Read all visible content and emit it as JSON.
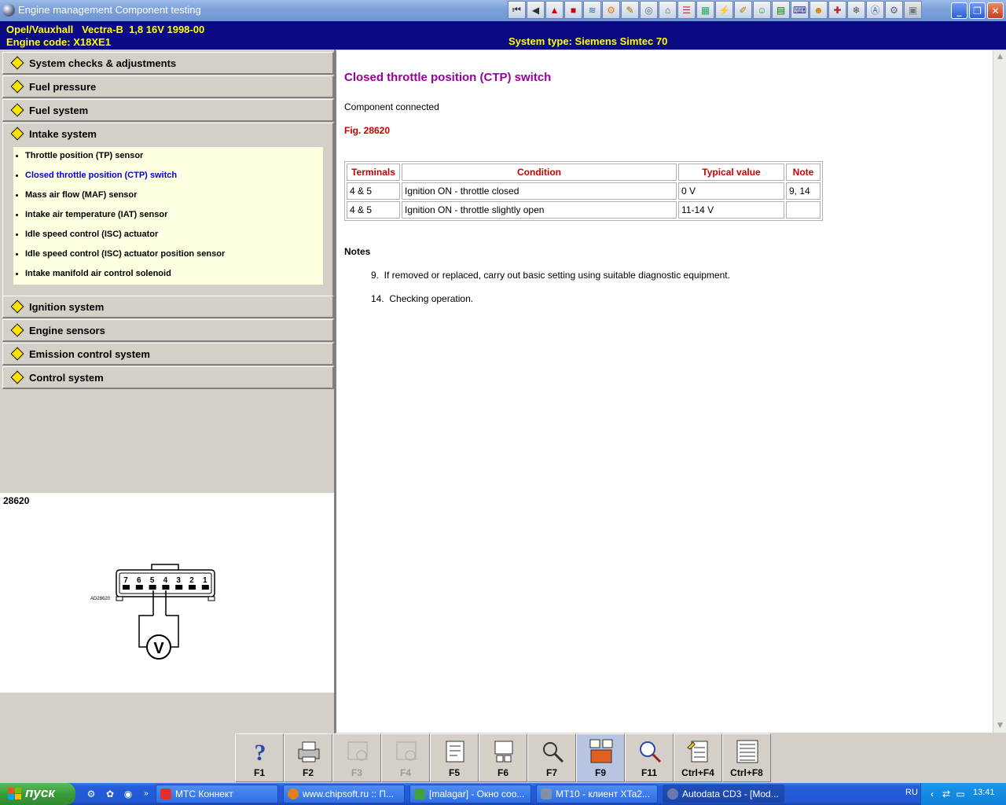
{
  "window": {
    "title": "Engine management Component testing"
  },
  "header": {
    "vehicle": "Opel/Vauxhall   Vectra-B  1,8 16V 1998-00",
    "engine_code": "Engine code: X18XE1",
    "system_type": "System type: Siemens Simtec 70"
  },
  "sections": [
    {
      "label": "System checks & adjustments"
    },
    {
      "label": "Fuel pressure"
    },
    {
      "label": "Fuel system"
    },
    {
      "label": "Intake system"
    },
    {
      "label": "Ignition system"
    },
    {
      "label": "Engine sensors"
    },
    {
      "label": "Emission control system"
    },
    {
      "label": "Control system"
    }
  ],
  "intake_items": [
    {
      "label": "Throttle position (TP) sensor"
    },
    {
      "label": "Closed throttle position (CTP) switch"
    },
    {
      "label": "Mass air flow (MAF) sensor"
    },
    {
      "label": "Intake air temperature (IAT) sensor"
    },
    {
      "label": "Idle speed control (ISC) actuator"
    },
    {
      "label": "Idle speed control (ISC) actuator position sensor"
    },
    {
      "label": "Intake manifold air control solenoid"
    }
  ],
  "figure": {
    "number": "28620",
    "code": "AD28620",
    "pins": [
      "7",
      "6",
      "5",
      "4",
      "3",
      "2",
      "1"
    ],
    "meter": "V"
  },
  "content": {
    "title": "Closed throttle position (CTP) switch",
    "connection": "Component connected",
    "fig_ref": "Fig. 28620",
    "table": {
      "headers": [
        "Terminals",
        "Condition",
        "Typical value",
        "Note"
      ],
      "rows": [
        [
          "4 & 5",
          "Ignition ON - throttle closed",
          "0 V",
          "9, 14"
        ],
        [
          "4 & 5",
          "Ignition ON - throttle slightly open",
          "11-14 V",
          ""
        ]
      ]
    },
    "notes_heading": "Notes",
    "notes": [
      "9.  If removed or replaced, carry out basic setting using suitable diagnostic equipment.",
      "14.  Checking operation."
    ]
  },
  "fkeys": [
    {
      "label": "F1",
      "icon": "help-icon"
    },
    {
      "label": "F2",
      "icon": "printer-icon"
    },
    {
      "label": "F3",
      "icon": "component-location-icon"
    },
    {
      "label": "F4",
      "icon": "engine-icon"
    },
    {
      "label": "F5",
      "icon": "pin-data-icon"
    },
    {
      "label": "F6",
      "icon": "connector-icon"
    },
    {
      "label": "F7",
      "icon": "magnifier-icon"
    },
    {
      "label": "F9",
      "icon": "fault-codes-icon"
    },
    {
      "label": "F11",
      "icon": "zoom-search-icon"
    },
    {
      "label": "Ctrl+F4",
      "icon": "notepad-icon"
    },
    {
      "label": "Ctrl+F8",
      "icon": "list-icon"
    }
  ],
  "taskbar": {
    "start_label": "пуск",
    "tasks": [
      "МТС Коннект",
      "www.chipsoft.ru :: П...",
      "[malagar] - Окно соо...",
      "MT10 - клиент XTa2...",
      "Autodata CD3 - [Mod..."
    ],
    "language": "RU",
    "clock": "13:41"
  },
  "colors": {
    "header_bg": "#0a0a84",
    "header_text": "#ffff00",
    "title_purple": "#990099",
    "accent_red": "#cc0000",
    "active_link": "#0000dd",
    "subpanel_bg": "#ffffe1"
  }
}
